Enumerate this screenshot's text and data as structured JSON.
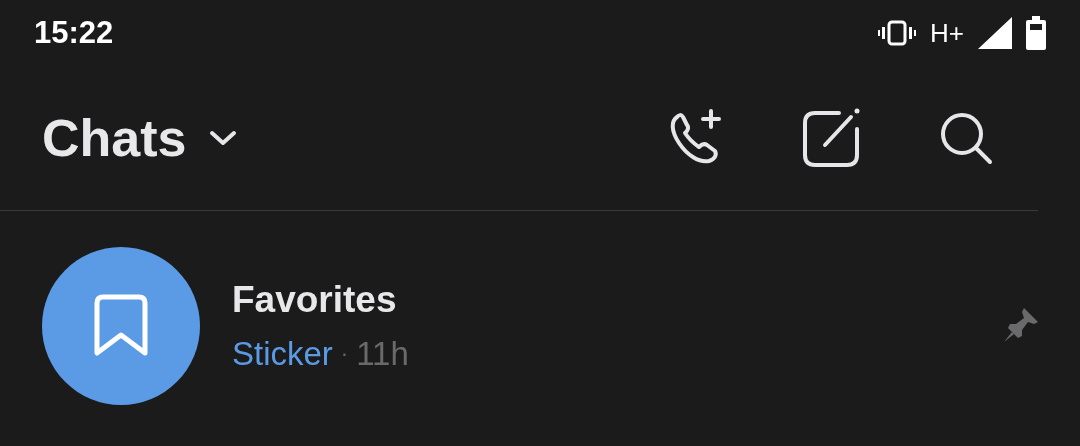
{
  "status_bar": {
    "time": "15:22",
    "network": "H+"
  },
  "header": {
    "title": "Chats"
  },
  "chats": [
    {
      "name": "Favorites",
      "preview": "Sticker",
      "separator": "·",
      "time": "11h",
      "pinned": true,
      "color": "#5b9be6"
    }
  ]
}
